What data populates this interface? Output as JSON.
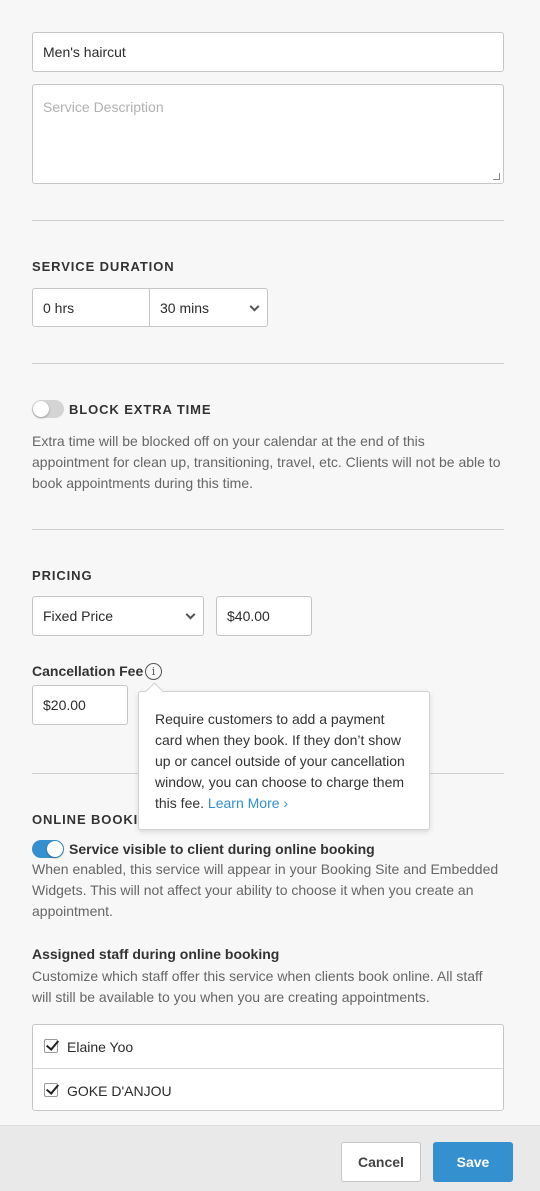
{
  "service": {
    "name_value": "Men's haircut",
    "description_placeholder": "Service Description"
  },
  "duration": {
    "title": "SERVICE DURATION",
    "hours_value": "0 hrs",
    "minutes_value": "30 mins"
  },
  "block_extra_time": {
    "title": "BLOCK EXTRA TIME",
    "enabled": false,
    "help": "Extra time will be blocked off on your calendar at the end of this appointment for clean up, transitioning, travel, etc. Clients will not be able to book appointments during this time."
  },
  "pricing": {
    "title": "PRICING",
    "price_type_value": "Fixed Price",
    "price_value": "$40.00",
    "cancellation_label": "Cancellation Fee",
    "cancellation_value": "$20.00"
  },
  "tooltip": {
    "text": "Require customers to add a payment card when they book. If they don’t show up or cancel outside of your cancellation window, you can choose to charge them this fee.",
    "link": "Learn More ›"
  },
  "online_booking": {
    "title": "ONLINE BOOKI",
    "visible_label": "Service visible to client during online booking",
    "visible_enabled": true,
    "visible_help": "When enabled, this service will appear in your Booking Site and Embedded Widgets. This will not affect your ability to choose it when you create an appointment.",
    "staff_title": "Assigned staff during online booking",
    "staff_help": "Customize which staff offer this service when clients book online. All staff will still be available to you when you are creating appointments.",
    "staff": [
      {
        "name": "Elaine Yoo",
        "checked": true
      },
      {
        "name": "GOKE D'ANJOU",
        "checked": true
      }
    ]
  },
  "footer": {
    "cancel_label": "Cancel",
    "save_label": "Save"
  },
  "colors": {
    "accent": "#3590d0",
    "toggle_off": "#d4d4d4",
    "link": "#2f8fd1"
  }
}
